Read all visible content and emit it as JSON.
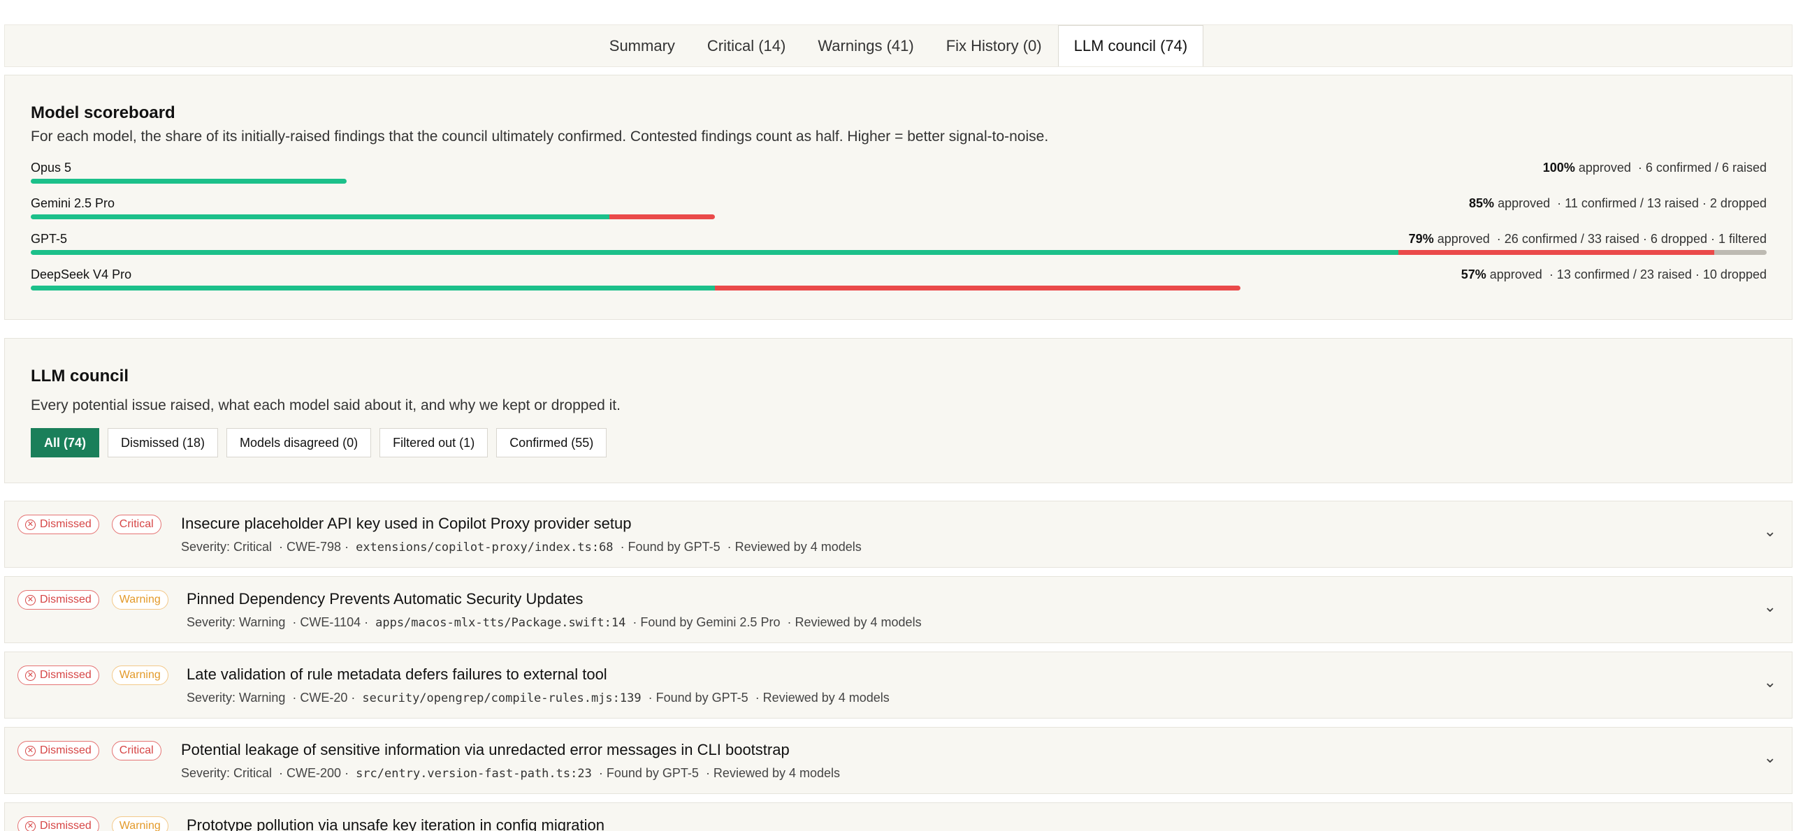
{
  "tabs": [
    {
      "label": "Summary"
    },
    {
      "label": "Critical (14)"
    },
    {
      "label": "Warnings (41)"
    },
    {
      "label": "Fix History (0)"
    },
    {
      "label": "LLM council (74)",
      "active": true
    }
  ],
  "scoreboard": {
    "title": "Model scoreboard",
    "description": "For each model, the share of its initially-raised findings that the council ultimately confirmed. Contested findings count as half. Higher = better signal-to-noise.",
    "models": [
      {
        "name": "Opus 5",
        "pct": "100%",
        "approved_label": "approved",
        "detail": "· 6 confirmed / 6 raised",
        "confirmed": 6,
        "dropped": 0,
        "filtered": 0
      },
      {
        "name": "Gemini 2.5 Pro",
        "pct": "85%",
        "approved_label": "approved",
        "detail": "· 11 confirmed / 13 raised · 2 dropped",
        "confirmed": 11,
        "dropped": 2,
        "filtered": 0
      },
      {
        "name": "GPT-5",
        "pct": "79%",
        "approved_label": "approved",
        "detail": "· 26 confirmed / 33 raised · 6 dropped · 1 filtered",
        "confirmed": 26,
        "dropped": 6,
        "filtered": 1
      },
      {
        "name": "DeepSeek V4 Pro",
        "pct": "57%",
        "approved_label": "approved",
        "detail": "· 13 confirmed / 23 raised · 10 dropped",
        "confirmed": 13,
        "dropped": 10,
        "filtered": 0
      }
    ],
    "colors": {
      "confirmed": "#1cc08a",
      "dropped": "#ea4a4a",
      "filtered": "#bdbab2"
    }
  },
  "council": {
    "title": "LLM council",
    "description": "Every potential issue raised, what each model said about it, and why we kept or dropped it.",
    "filters": [
      {
        "label": "All (74)",
        "active": true
      },
      {
        "label": "Dismissed (18)"
      },
      {
        "label": "Models disagreed (0)"
      },
      {
        "label": "Filtered out (1)"
      },
      {
        "label": "Confirmed (55)"
      }
    ]
  },
  "findings": [
    {
      "status": "Dismissed",
      "severity": "Critical",
      "title": "Insecure placeholder API key used in Copilot Proxy provider setup",
      "meta_severity": "Severity: Critical",
      "cwe": "· CWE-798  ·",
      "path": "extensions/copilot-proxy/index.ts:68",
      "found_by": "· Found by GPT-5",
      "reviewed": "· Reviewed by 4 models"
    },
    {
      "status": "Dismissed",
      "severity": "Warning",
      "title": "Pinned Dependency Prevents Automatic Security Updates",
      "meta_severity": "Severity: Warning",
      "cwe": "· CWE-1104  ·",
      "path": "apps/macos-mlx-tts/Package.swift:14",
      "found_by": "· Found by Gemini 2.5 Pro",
      "reviewed": "· Reviewed by 4 models"
    },
    {
      "status": "Dismissed",
      "severity": "Warning",
      "title": "Late validation of rule metadata defers failures to external tool",
      "meta_severity": "Severity: Warning",
      "cwe": "· CWE-20  ·",
      "path": "security/opengrep/compile-rules.mjs:139",
      "found_by": "· Found by GPT-5",
      "reviewed": "· Reviewed by 4 models"
    },
    {
      "status": "Dismissed",
      "severity": "Critical",
      "title": "Potential leakage of sensitive information via unredacted error messages in CLI bootstrap",
      "meta_severity": "Severity: Critical",
      "cwe": "· CWE-200  ·",
      "path": "src/entry.version-fast-path.ts:23",
      "found_by": "· Found by GPT-5",
      "reviewed": "· Reviewed by 4 models"
    },
    {
      "status": "Dismissed",
      "severity": "Warning",
      "title": "Prototype pollution via unsafe key iteration in config migration",
      "meta_severity": "",
      "cwe": "",
      "path": "",
      "found_by": "",
      "reviewed": ""
    }
  ]
}
